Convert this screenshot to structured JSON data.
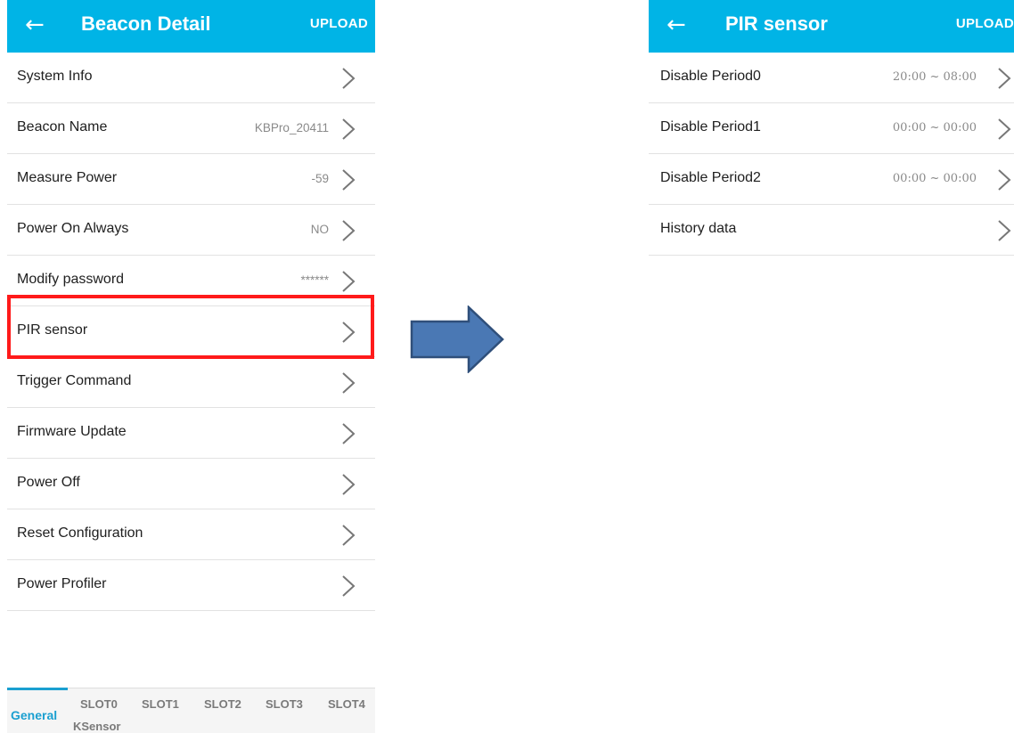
{
  "left_screen": {
    "header": {
      "back_icon": "arrow-left-icon",
      "title": "Beacon Detail",
      "upload_label": "UPLOAD"
    },
    "items": [
      {
        "label": "System Info",
        "value": ""
      },
      {
        "label": "Beacon Name",
        "value": "KBPro_20411"
      },
      {
        "label": "Measure Power",
        "value": "-59"
      },
      {
        "label": "Power On Always",
        "value": "NO"
      },
      {
        "label": "Modify password",
        "value": "******"
      },
      {
        "label": "PIR sensor",
        "value": ""
      },
      {
        "label": "Trigger Command",
        "value": ""
      },
      {
        "label": "Firmware Update",
        "value": ""
      },
      {
        "label": "Power Off",
        "value": ""
      },
      {
        "label": "Reset Configuration",
        "value": ""
      },
      {
        "label": "Power Profiler",
        "value": ""
      }
    ],
    "highlight_color": "#ff1a1a",
    "tabs": {
      "general": "General",
      "slot0": "SLOT0",
      "slot1": "SLOT1",
      "slot2": "SLOT2",
      "slot3": "SLOT3",
      "slot4": "SLOT4",
      "ksensor": "KSensor"
    }
  },
  "right_screen": {
    "header": {
      "back_icon": "arrow-left-icon",
      "title": "PIR sensor",
      "upload_label": "UPLOAD"
    },
    "items": [
      {
        "label": "Disable Period0",
        "value": "20:00 ~ 08:00"
      },
      {
        "label": "Disable Period1",
        "value": "00:00 ~ 00:00"
      },
      {
        "label": "Disable Period2",
        "value": "00:00 ~ 00:00"
      },
      {
        "label": "History data",
        "value": ""
      }
    ]
  },
  "colors": {
    "app_bar": "#00b4e6",
    "active_tab": "#1a9fd0",
    "arrow_fill": "#4a78b4",
    "arrow_stroke": "#2f4f7a"
  }
}
